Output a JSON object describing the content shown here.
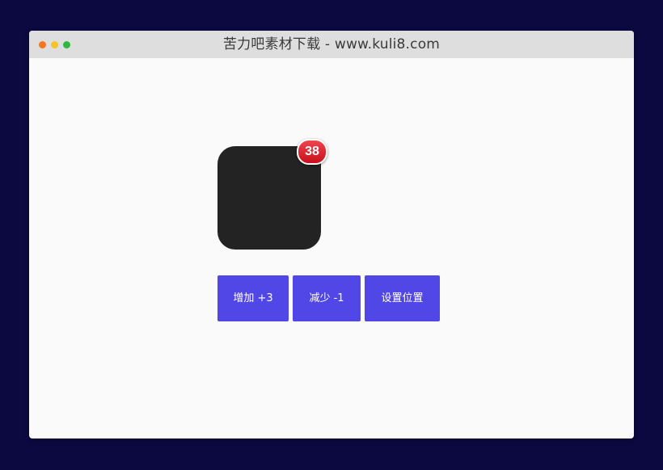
{
  "window": {
    "title": "苦力吧素材下载 - www.kuli8.com"
  },
  "badge": {
    "count": "38"
  },
  "buttons": {
    "add_label": "增加 +3",
    "subtract_label": "减少 -1",
    "position_label": "设置位置"
  },
  "colors": {
    "page_background": "#0b0940",
    "titlebar": "#dedede",
    "content_background": "#fafafb",
    "icon_box": "#232323",
    "badge": "#e0202a",
    "button": "#5147e6"
  }
}
